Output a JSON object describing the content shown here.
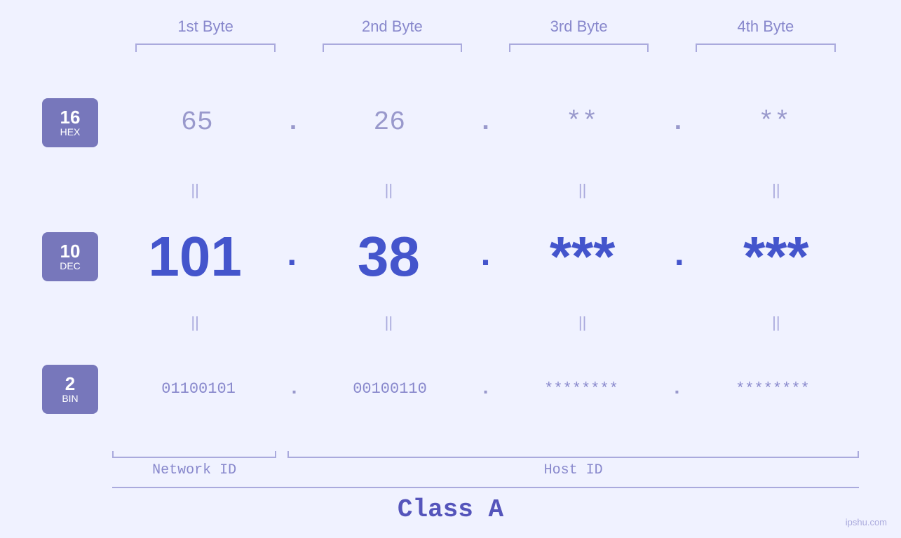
{
  "byteLabels": [
    "1st Byte",
    "2nd Byte",
    "3rd Byte",
    "4th Byte"
  ],
  "bases": [
    {
      "number": "16",
      "label": "HEX"
    },
    {
      "number": "10",
      "label": "DEC"
    },
    {
      "number": "2",
      "label": "BIN"
    }
  ],
  "hexRow": {
    "values": [
      "65",
      "26",
      "**",
      "**"
    ],
    "dots": [
      ".",
      ".",
      ".",
      ""
    ]
  },
  "decRow": {
    "values": [
      "101",
      "38",
      "***",
      "***"
    ],
    "dots": [
      ".",
      ".",
      ".",
      ""
    ]
  },
  "binRow": {
    "values": [
      "01100101",
      "00100110",
      "********",
      "********"
    ],
    "dots": [
      ".",
      ".",
      ".",
      ""
    ]
  },
  "networkIdLabel": "Network ID",
  "hostIdLabel": "Host ID",
  "classLabel": "Class A",
  "watermark": "ipshu.com"
}
